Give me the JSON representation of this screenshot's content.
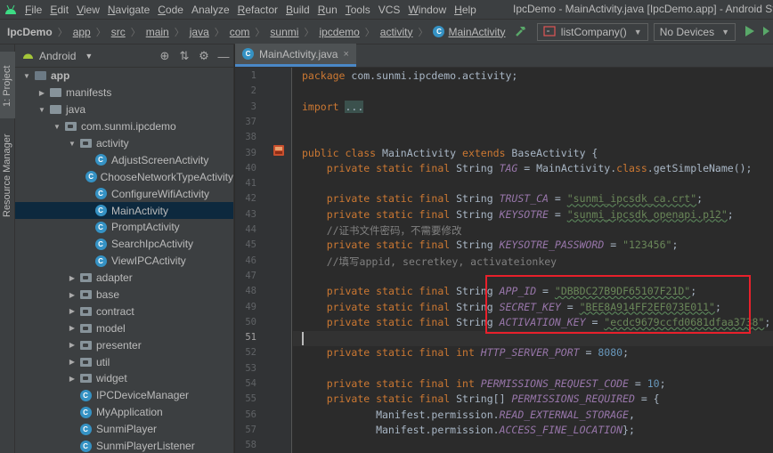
{
  "menubar": {
    "items": [
      {
        "label": "File",
        "key": "F",
        "rest": "ile"
      },
      {
        "label": "Edit",
        "key": "E",
        "rest": "dit"
      },
      {
        "label": "View",
        "key": "V",
        "rest": "iew"
      },
      {
        "label": "Navigate",
        "key": "N",
        "rest": "avigate"
      },
      {
        "label": "Code",
        "key": "C",
        "rest": "ode"
      },
      {
        "label": "Analyze",
        "key": "",
        "rest": "Analyze"
      },
      {
        "label": "Refactor",
        "key": "R",
        "rest": "efactor"
      },
      {
        "label": "Build",
        "key": "B",
        "rest": "uild"
      },
      {
        "label": "Run",
        "key": "R",
        "rest": "un"
      },
      {
        "label": "Tools",
        "key": "T",
        "rest": "ools"
      },
      {
        "label": "VCS",
        "key": "",
        "rest": "VCS"
      },
      {
        "label": "Window",
        "key": "W",
        "rest": "indow"
      },
      {
        "label": "Help",
        "key": "H",
        "rest": "elp"
      }
    ],
    "window_title": "IpcDemo - MainActivity.java [IpcDemo.app] - Android Studio"
  },
  "navbar": {
    "breadcrumbs": [
      "IpcDemo",
      "app",
      "src",
      "main",
      "java",
      "com",
      "sunmi",
      "ipcdemo",
      "activity",
      "MainActivity"
    ],
    "run_config": "listCompany()",
    "device": "No Devices"
  },
  "stripe": {
    "project_tab": "1: Project",
    "resource_tab": "Resource Manager"
  },
  "project_panel": {
    "view_mode": "Android",
    "tree": [
      {
        "label": "app",
        "depth": 0,
        "expanded": "open",
        "icon": "module-folder",
        "bold": true
      },
      {
        "label": "manifests",
        "depth": 1,
        "expanded": "closed",
        "icon": "folder"
      },
      {
        "label": "java",
        "depth": 1,
        "expanded": "open",
        "icon": "folder"
      },
      {
        "label": "com.sunmi.ipcdemo",
        "depth": 2,
        "expanded": "open",
        "icon": "package"
      },
      {
        "label": "activity",
        "depth": 3,
        "expanded": "open",
        "icon": "package"
      },
      {
        "label": "AdjustScreenActivity",
        "depth": 4,
        "icon": "class"
      },
      {
        "label": "ChooseNetworkTypeActivity",
        "depth": 4,
        "icon": "class"
      },
      {
        "label": "ConfigureWifiActivity",
        "depth": 4,
        "icon": "class"
      },
      {
        "label": "MainActivity",
        "depth": 4,
        "icon": "class",
        "selected": true
      },
      {
        "label": "PromptActivity",
        "depth": 4,
        "icon": "class"
      },
      {
        "label": "SearchIpcActivity",
        "depth": 4,
        "icon": "class"
      },
      {
        "label": "ViewIPCActivity",
        "depth": 4,
        "icon": "class"
      },
      {
        "label": "adapter",
        "depth": 3,
        "expanded": "closed",
        "icon": "package"
      },
      {
        "label": "base",
        "depth": 3,
        "expanded": "closed",
        "icon": "package"
      },
      {
        "label": "contract",
        "depth": 3,
        "expanded": "closed",
        "icon": "package"
      },
      {
        "label": "model",
        "depth": 3,
        "expanded": "closed",
        "icon": "package"
      },
      {
        "label": "presenter",
        "depth": 3,
        "expanded": "closed",
        "icon": "package"
      },
      {
        "label": "util",
        "depth": 3,
        "expanded": "closed",
        "icon": "package"
      },
      {
        "label": "widget",
        "depth": 3,
        "expanded": "closed",
        "icon": "package"
      },
      {
        "label": "IPCDeviceManager",
        "depth": 3,
        "icon": "class"
      },
      {
        "label": "MyApplication",
        "depth": 3,
        "icon": "class"
      },
      {
        "label": "SunmiPlayer",
        "depth": 3,
        "icon": "class"
      },
      {
        "label": "SunmiPlayerListener",
        "depth": 3,
        "icon": "class"
      }
    ]
  },
  "editor": {
    "tab_label": "MainActivity.java",
    "current_line": "51",
    "lines": [
      {
        "n": "1",
        "segs": [
          [
            "kw",
            "package "
          ],
          [
            "",
            "com.sunmi.ipcdemo.activity;"
          ]
        ]
      },
      {
        "n": "2",
        "segs": []
      },
      {
        "n": "3",
        "segs": [
          [
            "kw",
            "import "
          ],
          [
            "fold",
            "..."
          ]
        ]
      },
      {
        "n": "37",
        "segs": []
      },
      {
        "n": "38",
        "segs": []
      },
      {
        "n": "39",
        "segs": [
          [
            "kw",
            "public class "
          ],
          [
            "",
            "MainActivity "
          ],
          [
            "kw",
            "extends "
          ],
          [
            "",
            "BaseActivity {"
          ]
        ]
      },
      {
        "n": "40",
        "segs": [
          [
            "",
            "    "
          ],
          [
            "kw",
            "private static final "
          ],
          [
            "",
            "String "
          ],
          [
            "fld",
            "TAG"
          ],
          [
            "",
            " = MainActivity."
          ],
          [
            "kw",
            "class"
          ],
          [
            "",
            ".getSimpleName();"
          ]
        ]
      },
      {
        "n": "41",
        "segs": []
      },
      {
        "n": "42",
        "segs": [
          [
            "",
            "    "
          ],
          [
            "kw",
            "private static final "
          ],
          [
            "",
            "String "
          ],
          [
            "fld",
            "TRUST_CA"
          ],
          [
            "",
            " = "
          ],
          [
            "str",
            "\"sunmi_ipcsdk_ca.crt\""
          ],
          [
            "",
            ";"
          ]
        ]
      },
      {
        "n": "43",
        "segs": [
          [
            "",
            "    "
          ],
          [
            "kw",
            "private static final "
          ],
          [
            "",
            "String "
          ],
          [
            "fld",
            "KEYSOTRE"
          ],
          [
            "",
            " = "
          ],
          [
            "str",
            "\"sunmi_ipcsdk_openapi.p12\""
          ],
          [
            "",
            ";"
          ]
        ]
      },
      {
        "n": "44",
        "segs": [
          [
            "",
            "    "
          ],
          [
            "cmt",
            "//证书文件密码，不需要修改"
          ]
        ]
      },
      {
        "n": "45",
        "segs": [
          [
            "",
            "    "
          ],
          [
            "kw",
            "private static final "
          ],
          [
            "",
            "String "
          ],
          [
            "fld",
            "KEYSOTRE_PASSWORD"
          ],
          [
            "",
            " = "
          ],
          [
            "str",
            "\"123456\""
          ],
          [
            "",
            ";"
          ]
        ]
      },
      {
        "n": "46",
        "segs": [
          [
            "",
            "    "
          ],
          [
            "cmt",
            "//填写appid, secretkey, activateionkey"
          ]
        ]
      },
      {
        "n": "47",
        "segs": []
      },
      {
        "n": "48",
        "segs": [
          [
            "",
            "    "
          ],
          [
            "kw",
            "private static final "
          ],
          [
            "",
            "String "
          ],
          [
            "fld",
            "APP_ID"
          ],
          [
            "",
            " = "
          ],
          [
            "str",
            "\"DBBDC27B9DF65107F21D\""
          ],
          [
            "",
            ";"
          ]
        ]
      },
      {
        "n": "49",
        "segs": [
          [
            "",
            "    "
          ],
          [
            "kw",
            "private static final "
          ],
          [
            "",
            "String "
          ],
          [
            "fld",
            "SECRET_KEY"
          ],
          [
            "",
            " = "
          ],
          [
            "str",
            "\"BEE8A914FF2EF073E011\""
          ],
          [
            "",
            ";"
          ]
        ]
      },
      {
        "n": "50",
        "segs": [
          [
            "",
            "    "
          ],
          [
            "kw",
            "private static final "
          ],
          [
            "",
            "String "
          ],
          [
            "fld",
            "ACTIVATION_KEY"
          ],
          [
            "",
            " = "
          ],
          [
            "str",
            "\"ecdc9679ccfd0681dfaa3738\""
          ],
          [
            "",
            ";"
          ]
        ]
      },
      {
        "n": "51",
        "segs": []
      },
      {
        "n": "52",
        "segs": [
          [
            "",
            "    "
          ],
          [
            "kw",
            "private static final int "
          ],
          [
            "fld",
            "HTTP_SERVER_PORT"
          ],
          [
            "",
            " = "
          ],
          [
            "num",
            "8080"
          ],
          [
            "",
            ";"
          ]
        ]
      },
      {
        "n": "53",
        "segs": []
      },
      {
        "n": "54",
        "segs": [
          [
            "",
            "    "
          ],
          [
            "kw",
            "private static final int "
          ],
          [
            "fld",
            "PERMISSIONS_REQUEST_CODE"
          ],
          [
            "",
            " = "
          ],
          [
            "num",
            "10"
          ],
          [
            "",
            ";"
          ]
        ]
      },
      {
        "n": "55",
        "segs": [
          [
            "",
            "    "
          ],
          [
            "kw",
            "private static final "
          ],
          [
            "",
            "String[] "
          ],
          [
            "fld",
            "PERMISSIONS_REQUIRED"
          ],
          [
            "",
            " = {"
          ]
        ]
      },
      {
        "n": "56",
        "segs": [
          [
            "",
            "            Manifest.permission."
          ],
          [
            "fld",
            "READ_EXTERNAL_STORAGE"
          ],
          [
            "",
            ","
          ]
        ]
      },
      {
        "n": "57",
        "segs": [
          [
            "",
            "            Manifest.permission."
          ],
          [
            "fld",
            "ACCESS_FINE_LOCATION"
          ],
          [
            "",
            "};"
          ]
        ]
      },
      {
        "n": "58",
        "segs": []
      }
    ]
  }
}
